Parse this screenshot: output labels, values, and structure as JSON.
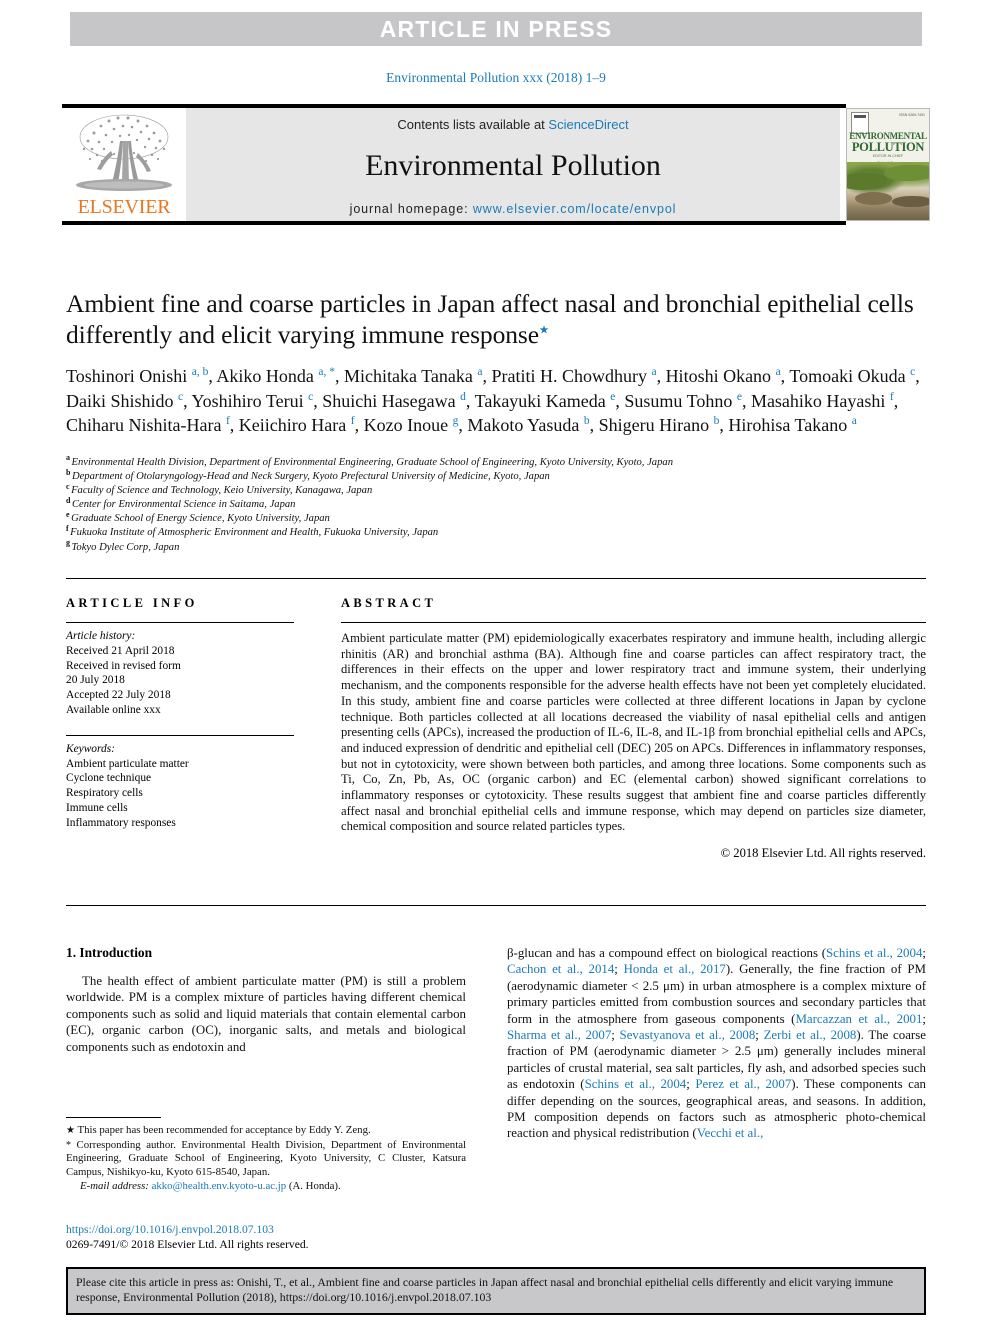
{
  "banner": {
    "label": "ARTICLE IN PRESS"
  },
  "running_head": "Environmental Pollution xxx (2018) 1–9",
  "masthead": {
    "contents_prefix": "Contents lists available at ",
    "sciencedirect": "ScienceDirect",
    "journal_title": "Environmental Pollution",
    "homepage_prefix": "journal homepage: ",
    "homepage_url": "www.elsevier.com/locate/envpol",
    "publisher_logo_text": "ELSEVIER",
    "cover": {
      "line1": "ENVIRONMENTAL",
      "line2": "POLLUTION",
      "sub1": "EDITOR-IN-CHIEF",
      "sub2": "Eddy Y. Zeng",
      "issn": "ISSN 0269-7491"
    }
  },
  "article": {
    "title": "Ambient fine and coarse particles in Japan affect nasal and bronchial epithelial cells differently and elicit varying immune response",
    "title_mark": "★",
    "authors": [
      {
        "name": "Toshinori Onishi",
        "marks": "a, b",
        "sep": ", "
      },
      {
        "name": "Akiko Honda",
        "marks": "a, *",
        "sep": ", "
      },
      {
        "name": "Michitaka Tanaka",
        "marks": "a",
        "sep": ", "
      },
      {
        "name": "Pratiti H. Chowdhury",
        "marks": "a",
        "sep": ", "
      },
      {
        "name": "Hitoshi Okano",
        "marks": "a",
        "sep": ", "
      },
      {
        "name": "Tomoaki Okuda",
        "marks": "c",
        "sep": ", "
      },
      {
        "name": "Daiki Shishido",
        "marks": "c",
        "sep": ", "
      },
      {
        "name": "Yoshihiro Terui",
        "marks": "c",
        "sep": ", "
      },
      {
        "name": "Shuichi Hasegawa",
        "marks": "d",
        "sep": ", "
      },
      {
        "name": "Takayuki Kameda",
        "marks": "e",
        "sep": ", "
      },
      {
        "name": "Susumu Tohno",
        "marks": "e",
        "sep": ", "
      },
      {
        "name": "Masahiko Hayashi",
        "marks": "f",
        "sep": ", "
      },
      {
        "name": "Chiharu Nishita-Hara",
        "marks": "f",
        "sep": ", "
      },
      {
        "name": "Keiichiro Hara",
        "marks": "f",
        "sep": ", "
      },
      {
        "name": "Kozo Inoue",
        "marks": "g",
        "sep": ", "
      },
      {
        "name": "Makoto Yasuda",
        "marks": "b",
        "sep": ", "
      },
      {
        "name": "Shigeru Hirano",
        "marks": "b",
        "sep": ", "
      },
      {
        "name": "Hirohisa Takano",
        "marks": "a",
        "sep": ""
      }
    ],
    "affiliations": [
      {
        "mark": "a",
        "text": "Environmental Health Division, Department of Environmental Engineering, Graduate School of Engineering, Kyoto University, Kyoto, Japan"
      },
      {
        "mark": "b",
        "text": "Department of Otolaryngology-Head and Neck Surgery, Kyoto Prefectural University of Medicine, Kyoto, Japan"
      },
      {
        "mark": "c",
        "text": "Faculty of Science and Technology, Keio University, Kanagawa, Japan"
      },
      {
        "mark": "d",
        "text": "Center for Environmental Science in Saitama, Japan"
      },
      {
        "mark": "e",
        "text": "Graduate School of Energy Science, Kyoto University, Japan"
      },
      {
        "mark": "f",
        "text": "Fukuoka Institute of Atmospheric Environment and Health, Fukuoka University, Japan"
      },
      {
        "mark": "g",
        "text": "Tokyo Dylec Corp, Japan"
      }
    ]
  },
  "article_info": {
    "heading": "ARTICLE INFO",
    "history_label": "Article history:",
    "history": [
      "Received 21 April 2018",
      "Received in revised form",
      "20 July 2018",
      "Accepted 22 July 2018",
      "Available online xxx"
    ],
    "keywords_label": "Keywords:",
    "keywords": [
      "Ambient particulate matter",
      "Cyclone technique",
      "Respiratory cells",
      "Immune cells",
      "Inflammatory responses"
    ]
  },
  "abstract": {
    "heading": "ABSTRACT",
    "text": "Ambient particulate matter (PM) epidemiologically exacerbates respiratory and immune health, including allergic rhinitis (AR) and bronchial asthma (BA). Although fine and coarse particles can affect respiratory tract, the differences in their effects on the upper and lower respiratory tract and immune system, their underlying mechanism, and the components responsible for the adverse health effects have not been yet completely elucidated. In this study, ambient fine and coarse particles were collected at three different locations in Japan by cyclone technique. Both particles collected at all locations decreased the viability of nasal epithelial cells and antigen presenting cells (APCs), increased the production of IL-6, IL-8, and IL-1β from bronchial epithelial cells and APCs, and induced expression of dendritic and epithelial cell (DEC) 205 on APCs. Differences in inflammatory responses, but not in cytotoxicity, were shown between both particles, and among three locations. Some components such as Ti, Co, Zn, Pb, As, OC (organic carbon) and EC (elemental carbon) showed significant correlations to inflammatory responses or cytotoxicity. These results suggest that ambient fine and coarse particles differently affect nasal and bronchial epithelial cells and immune response, which may depend on particles size diameter, chemical composition and source related particles types.",
    "copyright": "© 2018 Elsevier Ltd. All rights reserved."
  },
  "introduction": {
    "heading": "1. Introduction",
    "left_paragraph": "The health effect of ambient particulate matter (PM) is still a problem worldwide. PM is a complex mixture of particles having different chemical components such as solid and liquid materials that contain elemental carbon (EC), organic carbon (OC), inorganic salts, and metals and biological components such as endotoxin and",
    "right_segments": [
      {
        "text": "β-glucan and has a compound effect on biological reactions (",
        "link": false
      },
      {
        "text": "Schins et al., 2004",
        "link": true
      },
      {
        "text": "; ",
        "link": false
      },
      {
        "text": "Cachon et al., 2014",
        "link": true
      },
      {
        "text": "; ",
        "link": false
      },
      {
        "text": "Honda et al., 2017",
        "link": true
      },
      {
        "text": "). Generally, the fine fraction of PM (aerodynamic diameter < 2.5 μm) in urban atmosphere is a complex mixture of primary particles emitted from combustion sources and secondary particles that form in the atmosphere from gaseous components (",
        "link": false
      },
      {
        "text": "Marcazzan et al., 2001",
        "link": true
      },
      {
        "text": "; ",
        "link": false
      },
      {
        "text": "Sharma et al., 2007",
        "link": true
      },
      {
        "text": "; ",
        "link": false
      },
      {
        "text": "Sevastyanova et al., 2008",
        "link": true
      },
      {
        "text": "; ",
        "link": false
      },
      {
        "text": "Zerbi et al., 2008",
        "link": true
      },
      {
        "text": "). The coarse fraction of PM (aerodynamic diameter > 2.5 μm) generally includes mineral particles of crustal material, sea salt particles, fly ash, and adsorbed species such as endotoxin (",
        "link": false
      },
      {
        "text": "Schins et al., 2004",
        "link": true
      },
      {
        "text": "; ",
        "link": false
      },
      {
        "text": "Perez et al., 2007",
        "link": true
      },
      {
        "text": "). These components can differ depending on the sources, geographical areas, and seasons. In addition, PM composition depends on factors such as atmospheric photo-chemical reaction and physical redistribution (",
        "link": false
      },
      {
        "text": "Vecchi et al.,",
        "link": true
      }
    ]
  },
  "footnotes": {
    "star_mark": "★",
    "star_text": "This paper has been recommended for acceptance by Eddy Y. Zeng.",
    "corr_mark": "*",
    "corr_text": "Corresponding author. Environmental Health Division, Department of Environmental Engineering, Graduate School of Engineering, Kyoto University, C Cluster, Katsura Campus, Nishikyo-ku, Kyoto 615-8540, Japan.",
    "email_label": "E-mail address:",
    "email": "akko@health.env.kyoto-u.ac.jp",
    "email_suffix": "(A. Honda).",
    "doi": "https://doi.org/10.1016/j.envpol.2018.07.103",
    "issn_line": "0269-7491/© 2018 Elsevier Ltd. All rights reserved."
  },
  "cite_box": {
    "text": "Please cite this article in press as: Onishi, T., et al., Ambient fine and coarse particles in Japan affect nasal and bronchial epithelial cells differently and elicit varying immune response, Environmental Pollution (2018), https://doi.org/10.1016/j.envpol.2018.07.103"
  },
  "colors": {
    "link_blue": "#1a7bb9",
    "banner_gray": "#c6c6c8",
    "panel_gray": "#e6e6e6",
    "elsevier_orange": "#e87722"
  }
}
